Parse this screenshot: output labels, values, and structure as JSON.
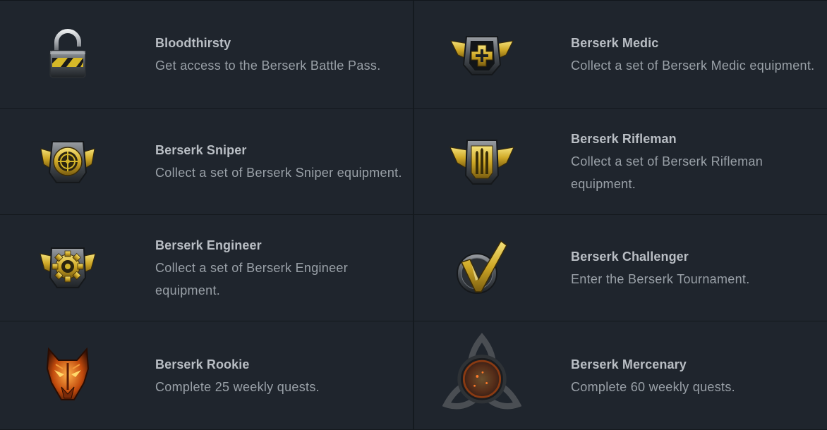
{
  "achievements": [
    {
      "title": "Bloodthirsty",
      "desc": "Get access to the Berserk Battle Pass.",
      "icon": "padlock-icon"
    },
    {
      "title": "Berserk Medic",
      "desc": "Collect a set of Berserk Medic equipment.",
      "icon": "medic-badge-icon"
    },
    {
      "title": "Berserk Sniper",
      "desc": "Collect a set of Berserk Sniper equipment.",
      "icon": "sniper-badge-icon"
    },
    {
      "title": "Berserk Rifleman",
      "desc": "Collect a set of Berserk Rifleman equipment.",
      "icon": "rifleman-badge-icon"
    },
    {
      "title": "Berserk Engineer",
      "desc": "Collect a set of Berserk Engineer equipment.",
      "icon": "engineer-badge-icon"
    },
    {
      "title": "Berserk Challenger",
      "desc": "Enter the Berserk Tournament.",
      "icon": "checkmark-badge-icon"
    },
    {
      "title": "Berserk Rookie",
      "desc": "Complete 25 weekly quests.",
      "icon": "wolf-mask-icon"
    },
    {
      "title": "Berserk Mercenary",
      "desc": "Complete 60 weekly quests.",
      "icon": "triquetra-emblem-icon"
    }
  ],
  "colors": {
    "background": "#1f252d",
    "title": "#b9bec4",
    "desc": "#9aa1a8",
    "gold": "#d4b62a"
  }
}
